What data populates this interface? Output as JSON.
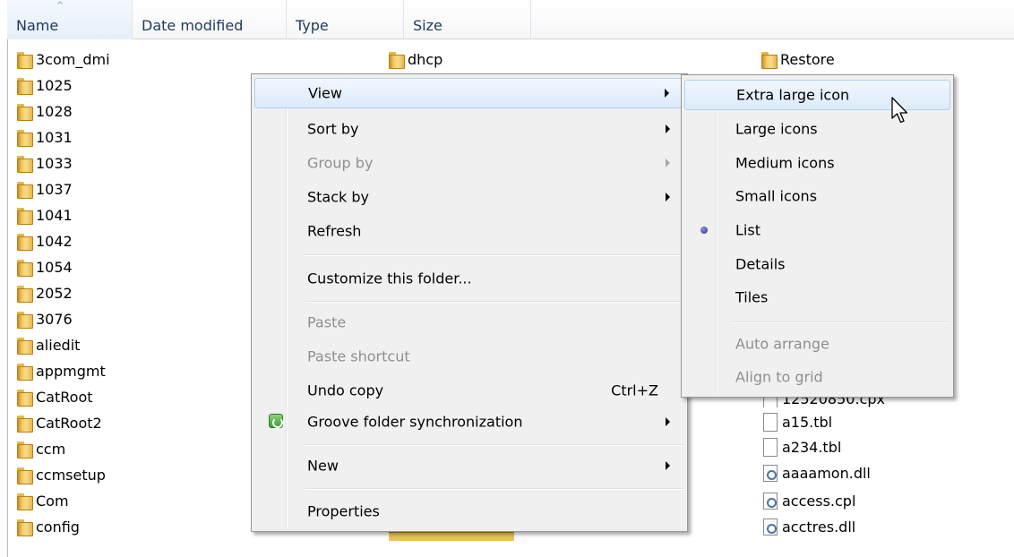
{
  "columns": [
    {
      "label": "Name"
    },
    {
      "label": "Date modified"
    },
    {
      "label": "Type"
    },
    {
      "label": "Size"
    }
  ],
  "files_col1": [
    "3com_dmi",
    "1025",
    "1028",
    "1031",
    "1033",
    "1037",
    "1041",
    "1042",
    "1054",
    "2052",
    "3076",
    "aliedit",
    "appmgmt",
    "CatRoot",
    "CatRoot2",
    "ccm",
    "ccmsetup",
    "Com",
    "config"
  ],
  "files_col2": {
    "top": "dhcp"
  },
  "files_col3": {
    "restore": "Restore",
    "partial_top": "12520850.cpx",
    "a15": "a15.tbl",
    "a234": "a234.tbl",
    "aaaamon": "aaaamon.dll",
    "access": "access.cpl",
    "acctres": "acctres.dll"
  },
  "context_menu": {
    "view": "View",
    "sort_by": "Sort by",
    "group_by": "Group by",
    "stack_by": "Stack by",
    "refresh": "Refresh",
    "customize": "Customize this folder...",
    "paste": "Paste",
    "paste_shortcut": "Paste shortcut",
    "undo_copy": "Undo copy",
    "undo_shortcut": "Ctrl+Z",
    "groove": "Groove folder synchronization",
    "new": "New",
    "properties": "Properties"
  },
  "view_submenu": {
    "extra_large": "Extra large icon",
    "large": "Large icons",
    "medium": "Medium icons",
    "small": "Small icons",
    "list": "List",
    "details": "Details",
    "tiles": "Tiles",
    "auto_arrange": "Auto arrange",
    "align_grid": "Align to grid",
    "selected": "List"
  },
  "colors": {
    "highlight_border": "#b3d1ef",
    "menu_bg": "#f0f0f0",
    "disabled_text": "#8f8f8f",
    "header_text": "#1e395b"
  }
}
